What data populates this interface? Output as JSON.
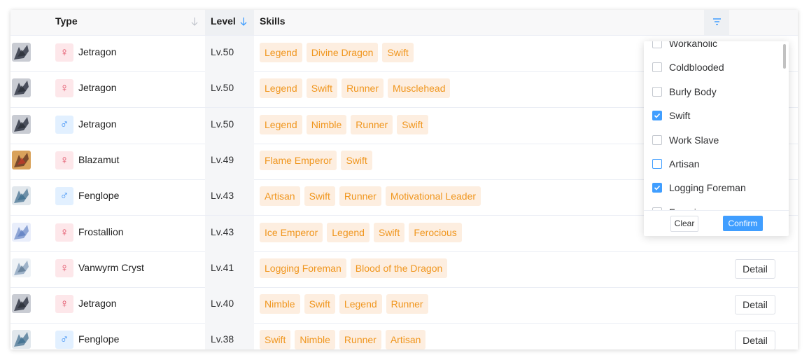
{
  "table": {
    "headers": {
      "type": "Type",
      "level": "Level",
      "skills": "Skills"
    },
    "rows": [
      {
        "gender": "female",
        "gender_symbol": "♀",
        "name": "Jetragon",
        "level": "Lv.50",
        "skills": [
          "Legend",
          "Divine Dragon",
          "Swift"
        ],
        "avatar_icon": "jetragon-icon",
        "detail_visible": false
      },
      {
        "gender": "female",
        "gender_symbol": "♀",
        "name": "Jetragon",
        "level": "Lv.50",
        "skills": [
          "Legend",
          "Swift",
          "Runner",
          "Musclehead"
        ],
        "avatar_icon": "jetragon-icon",
        "detail_visible": false
      },
      {
        "gender": "male",
        "gender_symbol": "♂",
        "name": "Jetragon",
        "level": "Lv.50",
        "skills": [
          "Legend",
          "Nimble",
          "Runner",
          "Swift"
        ],
        "avatar_icon": "jetragon-icon",
        "detail_visible": false
      },
      {
        "gender": "female",
        "gender_symbol": "♀",
        "name": "Blazamut",
        "level": "Lv.49",
        "skills": [
          "Flame Emperor",
          "Swift"
        ],
        "avatar_icon": "blazamut-icon",
        "detail_visible": false
      },
      {
        "gender": "male",
        "gender_symbol": "♂",
        "name": "Fenglope",
        "level": "Lv.43",
        "skills": [
          "Artisan",
          "Swift",
          "Runner",
          "Motivational Leader"
        ],
        "avatar_icon": "fenglope-icon",
        "detail_visible": false
      },
      {
        "gender": "female",
        "gender_symbol": "♀",
        "name": "Frostallion",
        "level": "Lv.43",
        "skills": [
          "Ice Emperor",
          "Legend",
          "Swift",
          "Ferocious"
        ],
        "avatar_icon": "frostallion-icon",
        "detail_visible": false
      },
      {
        "gender": "female",
        "gender_symbol": "♀",
        "name": "Vanwyrm Cryst",
        "level": "Lv.41",
        "skills": [
          "Logging Foreman",
          "Blood of the Dragon"
        ],
        "avatar_icon": "vanwyrm-icon",
        "detail_visible": true
      },
      {
        "gender": "female",
        "gender_symbol": "♀",
        "name": "Jetragon",
        "level": "Lv.40",
        "skills": [
          "Nimble",
          "Swift",
          "Legend",
          "Runner"
        ],
        "avatar_icon": "jetragon-icon",
        "detail_visible": true
      },
      {
        "gender": "male",
        "gender_symbol": "♂",
        "name": "Fenglope",
        "level": "Lv.38",
        "skills": [
          "Swift",
          "Nimble",
          "Runner",
          "Artisan"
        ],
        "avatar_icon": "fenglope-icon",
        "detail_visible": true
      }
    ],
    "detail_label": "Detail"
  },
  "filter": {
    "options": [
      {
        "label": "Workaholic",
        "checked": false
      },
      {
        "label": "Coldblooded",
        "checked": false
      },
      {
        "label": "Burly Body",
        "checked": false
      },
      {
        "label": "Swift",
        "checked": true
      },
      {
        "label": "Work Slave",
        "checked": false
      },
      {
        "label": "Artisan",
        "checked": false,
        "focused": true
      },
      {
        "label": "Logging Foreman",
        "checked": true
      },
      {
        "label": "Ferocious",
        "checked": false
      }
    ],
    "clear_label": "Clear",
    "confirm_label": "Confirm"
  },
  "colors": {
    "accent": "#409eff",
    "tag_bg": "#fdeee0",
    "tag_text": "#f0961e",
    "female_bg": "#fde7ea",
    "female_text": "#e0475e",
    "male_bg": "#e2f0ff",
    "male_text": "#3b8ff5"
  }
}
